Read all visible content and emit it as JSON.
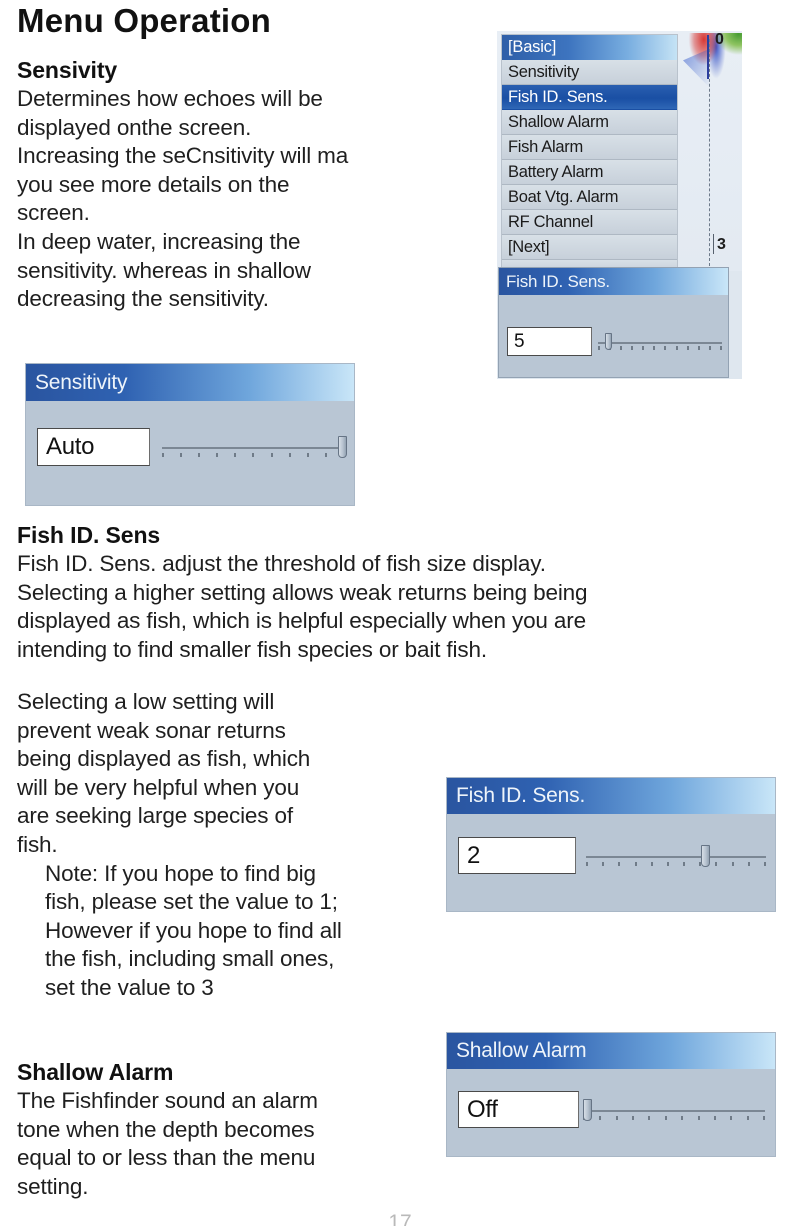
{
  "document": {
    "title": "Menu Operation",
    "page_number": "17"
  },
  "sections": {
    "sensivity": {
      "heading": "Sensivity",
      "lines": [
        "Determines how echoes will be",
        "displayed onthe screen.",
        "Increasing the seCnsitivity will ma",
        "you see more details on the",
        "screen.",
        "In deep water, increasing the",
        "sensitivity. whereas in shallow",
        "decreasing the sensitivity."
      ]
    },
    "fish_id_sens": {
      "heading": "Fish ID. Sens",
      "lines": [
        "Fish ID. Sens. adjust the threshold of fish size display.",
        "Selecting a higher setting allows weak returns being being",
        "displayed as fish, which is helpful especially when you are",
        "intending to find smaller fish species or bait fish."
      ]
    },
    "low_setting": {
      "lines": [
        "Selecting a low setting will",
        "prevent weak sonar returns",
        "being displayed as fish, which",
        "will be very helpful when you",
        "are seeking large species of",
        "fish."
      ],
      "note_lines": [
        "Note: If you hope to find big",
        "fish, please set the value to 1;",
        "However if you hope to find all",
        "the fish, including small ones,",
        "set the value to 3"
      ]
    },
    "shallow_alarm": {
      "heading": "Shallow Alarm",
      "lines": [
        "The Fishfinder sound an alarm",
        "tone when the depth becomes",
        "equal to or less than the menu",
        "setting."
      ]
    }
  },
  "device_screen": {
    "menu": {
      "header": "[Basic]",
      "items": [
        {
          "label": "Sensitivity",
          "selected": false
        },
        {
          "label": "Fish ID. Sens.",
          "selected": true
        },
        {
          "label": "Shallow Alarm",
          "selected": false
        },
        {
          "label": "Fish Alarm",
          "selected": false
        },
        {
          "label": "Battery Alarm",
          "selected": false
        },
        {
          "label": "Boat Vtg. Alarm",
          "selected": false
        },
        {
          "label": "RF Channel",
          "selected": false
        },
        {
          "label": "[Next]",
          "selected": false
        }
      ]
    },
    "sonar": {
      "depth_top_label": "0",
      "depth_mid_label": "3",
      "echo_colors": {
        "green": "#4e9628",
        "red": "#d72823",
        "blue": "#1e3cbe"
      }
    },
    "popup": {
      "title": "Fish ID. Sens.",
      "value": "5",
      "slider_percent": 8
    }
  },
  "panels": {
    "sensitivity": {
      "title": "Sensitivity",
      "value": "Auto",
      "slider_percent": 97
    },
    "fish_id_sens": {
      "title": "Fish ID. Sens.",
      "value": "2",
      "slider_percent": 65
    },
    "shallow_alarm": {
      "title": "Shallow Alarm",
      "value": "Off",
      "slider_percent": 2
    }
  },
  "theme": {
    "title_bar_start": "#2a55a0",
    "title_bar_end": "#c9e6f8",
    "panel_background": "#b9c6d4",
    "selection_blue": "#1a4fa4",
    "text_color": "#1a1a1a"
  }
}
